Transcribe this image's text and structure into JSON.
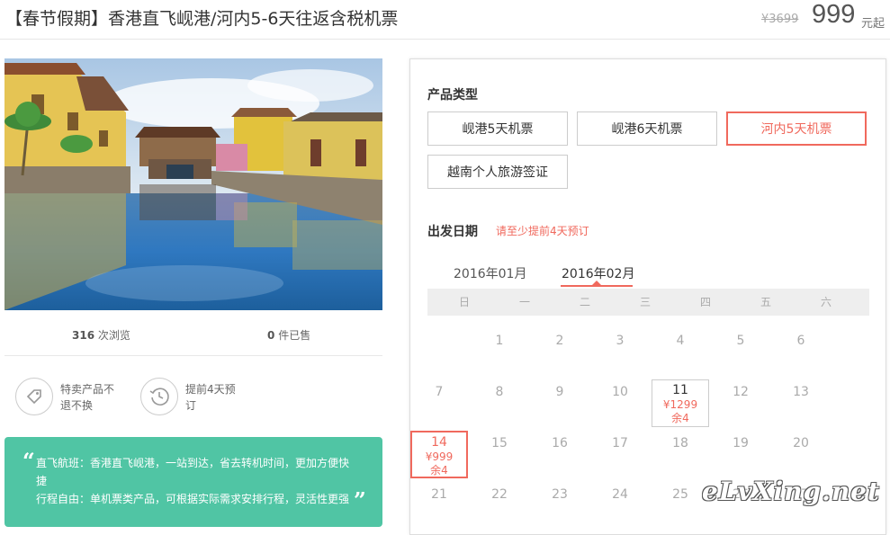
{
  "header": {
    "title": "【春节假期】香港直飞岘港/河内5-6天往返含税机票",
    "old_price": "¥3699",
    "price": "999",
    "price_unit": "元起"
  },
  "stats": {
    "views_count": "316",
    "views_label": "次浏览",
    "sold_count": "0",
    "sold_label": "件已售"
  },
  "features": [
    {
      "icon": "tag-icon",
      "text": "特卖产品不退不换"
    },
    {
      "icon": "clock-icon",
      "text": "提前4天预订"
    }
  ],
  "promo": {
    "line1": "直飞航班：香港直飞岘港，一站到达，省去转机时间，更加方便快捷",
    "line2": "行程自由：单机票类产品，可根据实际需求安排行程，灵活性更强"
  },
  "booking": {
    "product_type_label": "产品类型",
    "options": [
      "岘港5天机票",
      "岘港6天机票",
      "河内5天机票",
      "越南个人旅游签证"
    ],
    "selected_option": "河内5天机票",
    "date_label": "出发日期",
    "date_hint": "请至少提前4天预订",
    "months": [
      "2016年01月",
      "2016年02月"
    ],
    "active_month": "2016年02月",
    "weekdays": [
      "日",
      "一",
      "二",
      "三",
      "四",
      "五",
      "六"
    ],
    "days": [
      {
        "d": "1"
      },
      {
        "d": "2"
      },
      {
        "d": "3"
      },
      {
        "d": "4"
      },
      {
        "d": "5"
      },
      {
        "d": "6"
      },
      {
        "d": "7"
      },
      {
        "d": "8"
      },
      {
        "d": "9"
      },
      {
        "d": "10"
      },
      {
        "d": "11",
        "price": "¥1299",
        "remain": "余4"
      },
      {
        "d": "12"
      },
      {
        "d": "13"
      },
      {
        "d": "14",
        "price": "¥999",
        "remain": "余4",
        "selected": true
      },
      {
        "d": "15"
      },
      {
        "d": "16"
      },
      {
        "d": "17"
      },
      {
        "d": "18"
      },
      {
        "d": "19"
      },
      {
        "d": "20"
      },
      {
        "d": "21"
      },
      {
        "d": "22"
      },
      {
        "d": "23"
      },
      {
        "d": "24"
      },
      {
        "d": "25"
      },
      {
        "d": "26"
      },
      {
        "d": "27"
      }
    ]
  },
  "watermark": "eLvXing.net",
  "colors": {
    "accent": "#f0695d",
    "promo_bg": "#50c5a4"
  }
}
